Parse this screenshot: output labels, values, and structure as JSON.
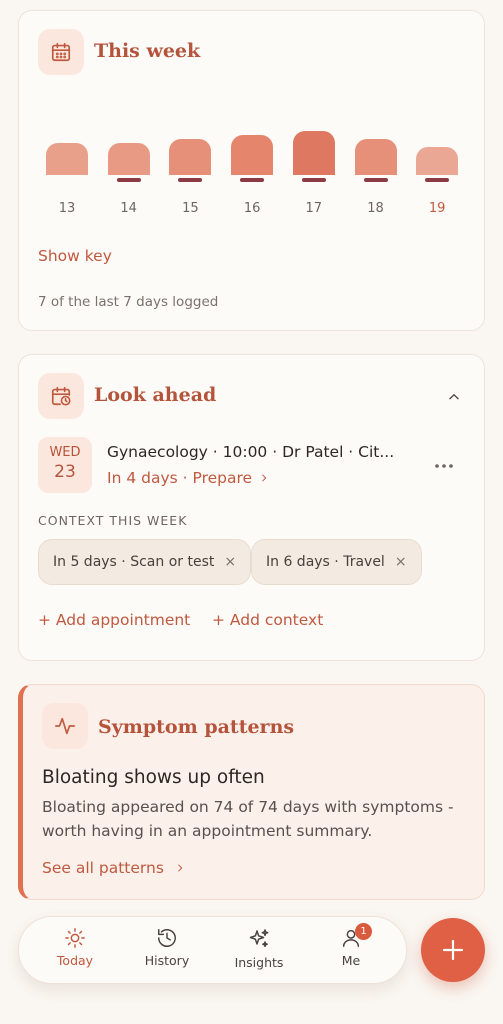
{
  "week_card": {
    "title": "This week",
    "icon": "calendar-icon",
    "days": [
      {
        "label": "13",
        "level": 0.53,
        "logged_mark": false,
        "color": "#e9a08a"
      },
      {
        "label": "14",
        "level": 0.53,
        "logged_mark": true,
        "color": "#e89a85"
      },
      {
        "label": "15",
        "level": 0.6,
        "logged_mark": true,
        "color": "#e6907a"
      },
      {
        "label": "16",
        "level": 0.67,
        "logged_mark": true,
        "color": "#e4856c"
      },
      {
        "label": "17",
        "level": 0.73,
        "logged_mark": true,
        "color": "#df7860"
      },
      {
        "label": "18",
        "level": 0.6,
        "logged_mark": true,
        "color": "#e6907a"
      },
      {
        "label": "19",
        "level": 0.47,
        "logged_mark": true,
        "color": "#eaa794",
        "today": true
      }
    ],
    "show_key": "Show key",
    "logged_summary": "7 of the last 7 days logged"
  },
  "look_ahead": {
    "title": "Look ahead",
    "icon": "calendar-clock-icon",
    "collapse_icon": "chevron-up-icon",
    "appointment": {
      "dow": "WED",
      "dom": "23",
      "title": "Gynaecology · 10:00 · Dr Patel · Cit...",
      "when": "In 4 days",
      "separator": "·",
      "prepare": "Prepare",
      "more_icon": "more-horizontal-icon"
    },
    "context_label": "CONTEXT THIS WEEK",
    "context_chips": [
      {
        "label": "In 5 days · Scan or test",
        "remove": "×"
      },
      {
        "label": "In 6 days · Travel",
        "remove": "×"
      }
    ],
    "add_appointment": "+ Add appointment",
    "add_context": "+ Add context"
  },
  "patterns": {
    "title": "Symptom patterns",
    "icon": "pulse-icon",
    "heading": "Bloating shows up often",
    "body": "Bloating appeared on 74 of 74 days with symptoms - worth having in an appointment summary.",
    "see_all": "See all patterns"
  },
  "nav": {
    "items": [
      {
        "label": "Today",
        "icon": "sun-icon",
        "active": true
      },
      {
        "label": "History",
        "icon": "history-icon"
      },
      {
        "label": "Insights",
        "icon": "sparkles-icon"
      },
      {
        "label": "Me",
        "icon": "user-icon",
        "badge": "1"
      }
    ],
    "fab_icon": "plus-icon"
  },
  "colors": {
    "accent": "#c0593f",
    "accent_fab": "#df6045",
    "tick": "#8c3a44",
    "background": "#faf6f1"
  }
}
